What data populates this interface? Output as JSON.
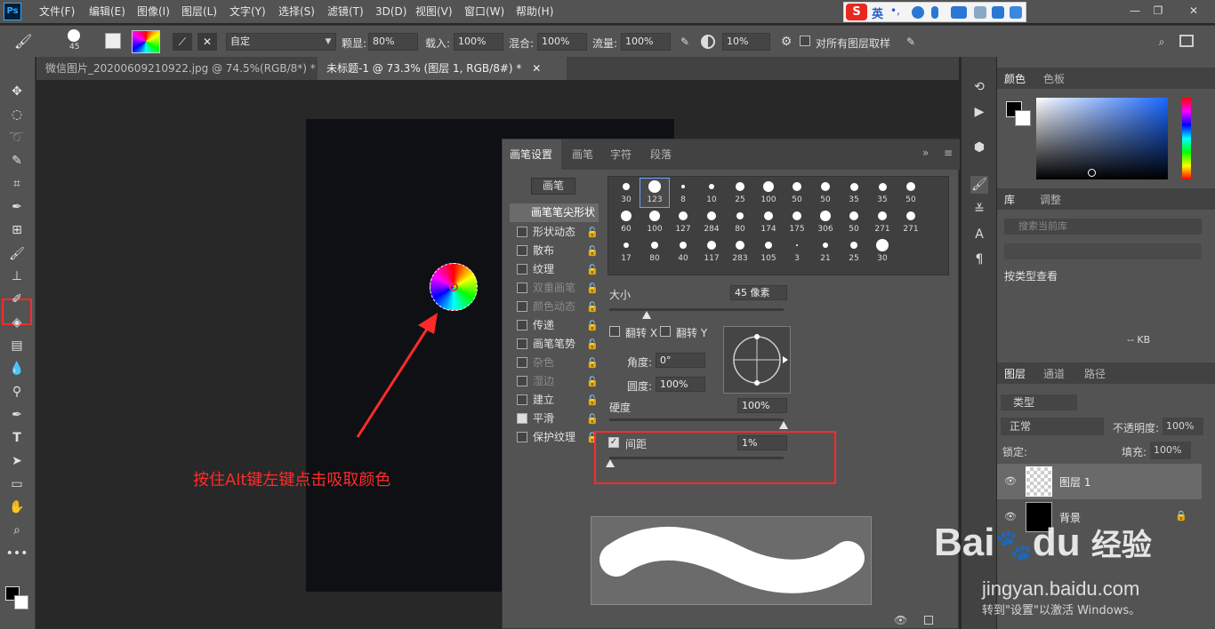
{
  "app": {
    "logo": "Ps"
  },
  "menu": [
    "文件(F)",
    "编辑(E)",
    "图像(I)",
    "图层(L)",
    "文字(Y)",
    "选择(S)",
    "滤镜(T)",
    "3D(D)",
    "视图(V)",
    "窗口(W)",
    "帮助(H)"
  ],
  "ime": {
    "logo": "S",
    "lang": "英",
    "punct": "•,"
  },
  "window_buttons": {
    "minimize": "—",
    "restore": "❐",
    "close": "✕"
  },
  "options": {
    "brush_size": "45",
    "preset": "自定",
    "opacity_label": "颗显:",
    "opacity": "80%",
    "load_label": "载入:",
    "load": "100%",
    "mix_label": "混合:",
    "mix": "100%",
    "flow_label": "流量:",
    "flow": "100%",
    "angle": "10%",
    "sample_all_label": "对所有图层取样"
  },
  "tabs": [
    {
      "label": "微信图片_20200609210922.jpg @ 74.5%(RGB/8*) *",
      "close": "✕"
    },
    {
      "label": "未标题-1 @ 73.3% (图层 1, RGB/8#) *",
      "close": "✕"
    }
  ],
  "annotation": "按住Alt键左键点击吸取颜色",
  "brush_panel": {
    "tabs": [
      "画笔设置",
      "画笔",
      "字符",
      "段落"
    ],
    "tab_more": "»",
    "menu": "≡",
    "brushes_button": "画笔",
    "tip_shape": "画笔笔尖形状",
    "options": [
      {
        "label": "形状动态",
        "checked": false,
        "dim": false
      },
      {
        "label": "散布",
        "checked": false,
        "dim": false
      },
      {
        "label": "纹理",
        "checked": false,
        "dim": false
      },
      {
        "label": "双重画笔",
        "checked": false,
        "dim": true
      },
      {
        "label": "颜色动态",
        "checked": false,
        "dim": true
      },
      {
        "label": "传递",
        "checked": false,
        "dim": false
      },
      {
        "label": "画笔笔势",
        "checked": false,
        "dim": false
      },
      {
        "label": "杂色",
        "checked": false,
        "dim": true
      },
      {
        "label": "湿边",
        "checked": false,
        "dim": true
      },
      {
        "label": "建立",
        "checked": false,
        "dim": false
      },
      {
        "label": "平滑",
        "checked": true,
        "dim": false
      },
      {
        "label": "保护纹理",
        "checked": false,
        "dim": false
      }
    ],
    "lock_icon": "🔓",
    "presets": [
      "30",
      "123",
      "8",
      "10",
      "25",
      "100",
      "50",
      "50",
      "35",
      "35",
      "50",
      "60",
      "100",
      "127",
      "284",
      "80",
      "174",
      "175",
      "306",
      "50",
      "271",
      "271",
      "17",
      "80",
      "40",
      "117",
      "283",
      "105",
      "3",
      "21",
      "25",
      "30"
    ],
    "size_label": "大小",
    "size_value": "45 像素",
    "flip_x": "翻转 X",
    "flip_y": "翻转 Y",
    "angle_label": "角度:",
    "angle_value": "0°",
    "roundness_label": "圆度:",
    "roundness_value": "100%",
    "hardness_label": "硬度",
    "hardness_value": "100%",
    "spacing_label": "间距",
    "spacing_value": "1%",
    "spacing_checked": true
  },
  "right": {
    "color_tabs": [
      "颜色",
      "色板"
    ],
    "library_tabs": [
      "库",
      "调整"
    ],
    "library_search": "搜索当前库",
    "view_by": "按类型查看",
    "kb": "-- KB",
    "layers_tabs": [
      "图层",
      "通道",
      "路径"
    ],
    "kind": "类型",
    "blend": "正常",
    "opacity_label": "不透明度:",
    "opacity": "100%",
    "lock_label": "锁定:",
    "fill_label": "填充:",
    "fill": "100%",
    "layers": [
      {
        "name": "图层 1",
        "selected": true
      },
      {
        "name": "背景",
        "selected": false
      }
    ]
  },
  "watermark": {
    "brand": "Bai",
    "brand2": "du",
    "jing": "经验",
    "url": "jingyan.baidu.com",
    "activation": "转到\"设置\"以激活 Windows。"
  },
  "colors": {
    "accent": "#ff2b2b",
    "selection": "#6aa3ff"
  }
}
